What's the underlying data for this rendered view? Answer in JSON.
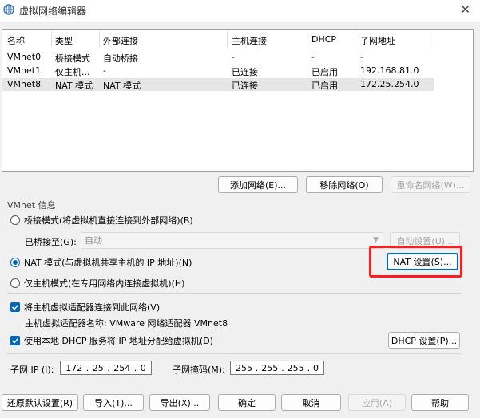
{
  "window": {
    "title": "虚拟网络编辑器"
  },
  "table": {
    "headers": [
      "名称",
      "类型",
      "外部连接",
      "主机连接",
      "DHCP",
      "子网地址"
    ],
    "rows": [
      [
        "VMnet0",
        "桥接模式",
        "自动桥接",
        "-",
        "-",
        "-"
      ],
      [
        "VMnet1",
        "仅主机...",
        "-",
        "已连接",
        "已启用",
        "192.168.81.0"
      ],
      [
        "VMnet8",
        "NAT 模式",
        "NAT 模式",
        "已连接",
        "已启用",
        "172.25.254.0"
      ]
    ],
    "selected_row": 2
  },
  "table_buttons": {
    "add_network": "添加网络(E)...",
    "remove_network": "移除网络(O)",
    "rename_network": "重命名网络(W)..."
  },
  "vmnet_info": {
    "title": "VMnet 信息",
    "bridged_mode": "桥接模式(将虚拟机直接连接到外部网络)(B)",
    "bridged_to_label": "已桥接至(G):",
    "bridged_to_value": "自动",
    "auto_settings": "自动设置(U)...",
    "nat_mode": "NAT 模式(与虚拟机共享主机的 IP 地址)(N)",
    "nat_settings": "NAT 设置(S)...",
    "host_only_mode": "仅主机模式(在专用网络内连接虚拟机)(H)",
    "selected_mode": "nat",
    "connect_host_adapter": "将主机虚拟适配器连接到此网络(V)",
    "host_adapter_name": "主机虚拟适配器名称: VMware 网络适配器 VMnet8",
    "use_dhcp": "使用本地 DHCP 服务将 IP 地址分配给虚拟机(D)",
    "dhcp_settings": "DHCP 设置(P)...",
    "subnet_ip_label": "子网 IP (I):",
    "subnet_ip": [
      "172",
      "25",
      "254",
      "0"
    ],
    "subnet_mask_label": "子网掩码(M):",
    "subnet_mask": [
      "255",
      "255",
      "255",
      "0"
    ]
  },
  "footer": {
    "restore_defaults": "还原默认设置(R)",
    "import": "导入(T)...",
    "export": "导出(X)...",
    "ok": "确定",
    "cancel": "取消",
    "apply": "应用(A)",
    "help": "帮助"
  },
  "colors": {
    "accent": "#0067c0",
    "highlight": "#ff1c1c"
  }
}
